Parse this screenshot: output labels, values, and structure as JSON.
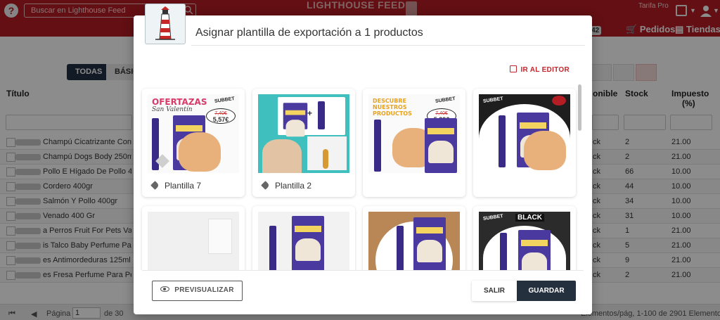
{
  "app": {
    "brand": "LIGHTHOUSE FEED",
    "search_placeholder": "Buscar en Lighthouse Feed",
    "tarifa": "Tarifa Pro",
    "nav": {
      "productos_count": "3242",
      "pedidos": "Pedidos",
      "tiendas": "Tiendas"
    },
    "filters": {
      "todas": "TODAS",
      "basic": "BÁSIC"
    },
    "columns": {
      "titulo": "Título",
      "disponible": "onible",
      "stock": "Stock",
      "impuesto": "Impuesto",
      "impuesto_unit": "(%)"
    },
    "rows": [
      {
        "name": "Champú Cicatrizante Con ...",
        "disp": "ck",
        "stock": "2",
        "tax": "21.00"
      },
      {
        "name": "Champú Dogs Body 250ml",
        "disp": "ck",
        "stock": "2",
        "tax": "21.00"
      },
      {
        "name": "Pollo E Hígado De Pollo 4...",
        "disp": "ck",
        "stock": "66",
        "tax": "10.00"
      },
      {
        "name": "Cordero 400gr",
        "disp": "ck",
        "stock": "44",
        "tax": "10.00"
      },
      {
        "name": "Salmón Y Pollo 400gr",
        "disp": "ck",
        "stock": "34",
        "tax": "10.00"
      },
      {
        "name": "Venado 400 Gr",
        "disp": "ck",
        "stock": "31",
        "tax": "10.00"
      },
      {
        "name": "a Perros Fruit For Pets Vai...",
        "disp": "ck",
        "stock": "1",
        "tax": "21.00"
      },
      {
        "name": "is Talco Baby Perfume Para...",
        "disp": "ck",
        "stock": "5",
        "tax": "21.00"
      },
      {
        "name": "es Antimordeduras 125ml",
        "disp": "ck",
        "stock": "9",
        "tax": "21.00"
      },
      {
        "name": "es Fresa Perfume Para Perr...",
        "disp": "ck",
        "stock": "2",
        "tax": "21.00"
      }
    ],
    "footer": {
      "pagina_label": "Página",
      "page_value": "1",
      "of_label": "de 30",
      "summary": "Elementos/pág, 1-100 de 2901 Elementos"
    }
  },
  "modal": {
    "title": "Asignar plantilla de exportación a 1 productos",
    "editor_link": "IR AL EDITOR",
    "templates": [
      {
        "caption": "Plantilla 7",
        "headline": "OFERTAZAS",
        "sub": "San Valentín",
        "old_price": "7,40€",
        "price": "5,57€"
      },
      {
        "caption": "Plantilla 2"
      },
      {
        "caption": "",
        "headline": "DESCUBRE NUESTROS PRODUCTOS",
        "old_price": "7,40€",
        "price": "5,39€"
      },
      {
        "caption": ""
      },
      {
        "caption": ""
      },
      {
        "caption": ""
      },
      {
        "caption": ""
      },
      {
        "caption": "",
        "headline": "BLACK"
      }
    ],
    "brand_mark": "SUBBET",
    "buttons": {
      "preview": "PREVISUALIZAR",
      "exit": "SALIR",
      "save": "GUARDAR"
    }
  },
  "colors": {
    "topbar": "#b51d24",
    "accent_red": "#c0262c",
    "navy": "#25303f"
  }
}
